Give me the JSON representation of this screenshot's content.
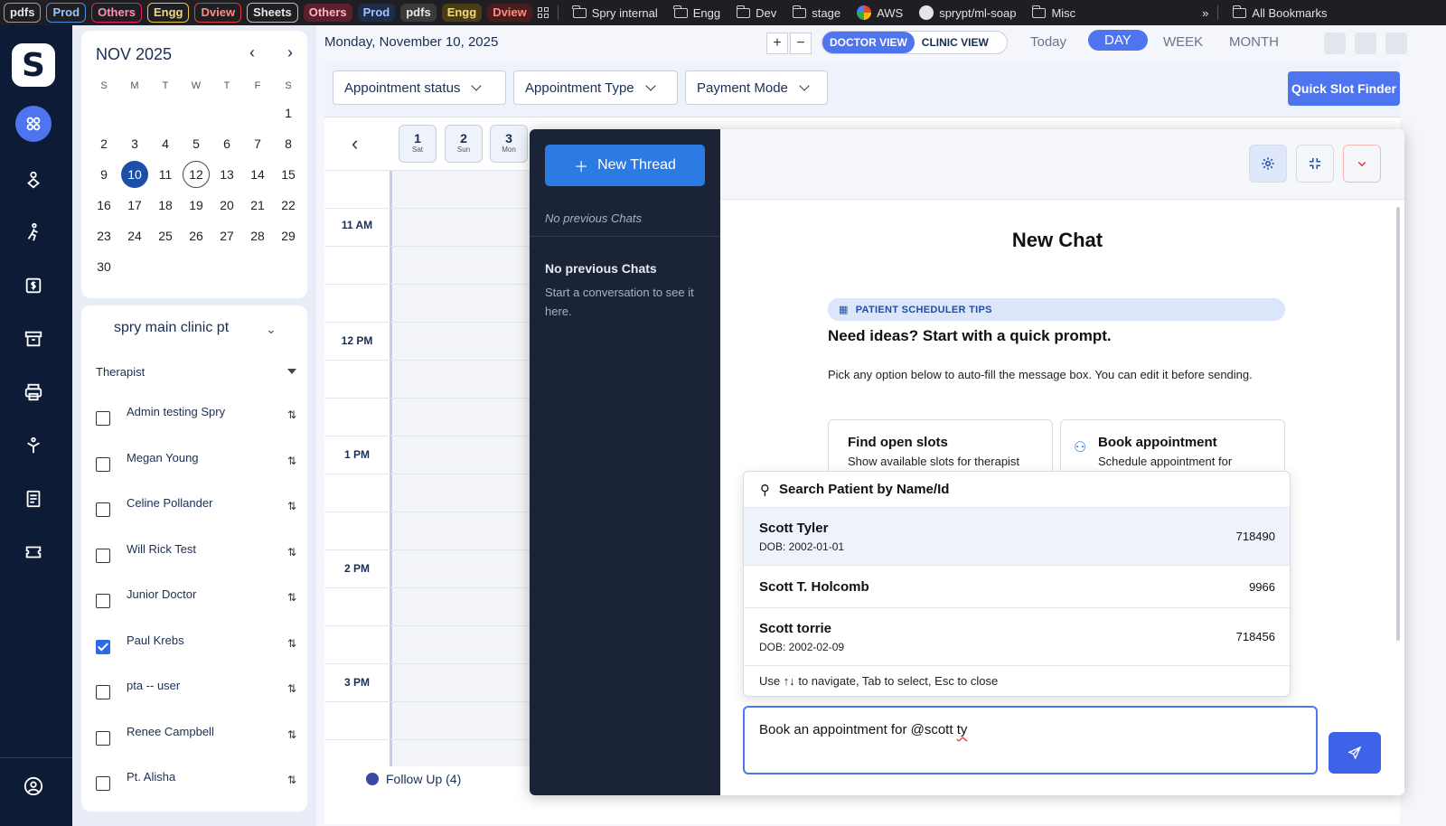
{
  "bookmarks": {
    "chips": [
      {
        "label": "pdfs",
        "color": "#9e9e9e"
      },
      {
        "label": "Prod",
        "color": "#4a90e2"
      },
      {
        "label": "Others",
        "color": "#e91e63"
      },
      {
        "label": "Engg",
        "color": "#f5c542"
      },
      {
        "label": "Dview",
        "color": "#e53935"
      },
      {
        "label": "Sheets",
        "color": "#bdbdbd"
      }
    ],
    "plain": [
      "Others",
      "Prod",
      "pdfs",
      "Engg",
      "Dview"
    ],
    "folders": [
      "Spry internal",
      "Engg",
      "Dev",
      "stage"
    ],
    "links": [
      "AWS",
      "sprypt/ml-soap"
    ],
    "misc_folder": "Misc",
    "overflow": "»",
    "all_bookmarks": "All Bookmarks"
  },
  "leftnav": {
    "logo": "S",
    "icons": [
      "dashboard-icon",
      "patients-icon",
      "exercise-icon",
      "billing-icon",
      "archive-icon",
      "print-icon",
      "therapy-icon",
      "documents-icon",
      "tickets-icon",
      "profile-icon"
    ]
  },
  "calendar": {
    "month_label": "NOV 2025",
    "prev": "‹",
    "next": "›",
    "weekdays": [
      "S",
      "M",
      "T",
      "W",
      "T",
      "F",
      "S"
    ],
    "leading_blanks": 6,
    "days": 30,
    "selected": 10,
    "today": 12
  },
  "therapists": {
    "clinic": "spry main clinic pt",
    "label": "Therapist",
    "list": [
      {
        "name": "Admin testing Spry",
        "checked": false
      },
      {
        "name": "Megan Young",
        "checked": false
      },
      {
        "name": "Celine Pollander",
        "checked": false
      },
      {
        "name": "Will Rick Test",
        "checked": false
      },
      {
        "name": "Junior Doctor",
        "checked": false
      },
      {
        "name": "Paul Krebs",
        "checked": true
      },
      {
        "name": "pta -- user",
        "checked": false
      },
      {
        "name": "Renee Campbell",
        "checked": false
      },
      {
        "name": "Pt. Alisha",
        "checked": false
      }
    ]
  },
  "header": {
    "date": "Monday, November 10, 2025",
    "zoom_in": "+",
    "zoom_out": "−",
    "doctor_view": "DOCTOR VIEW",
    "clinic_view": "CLINIC VIEW",
    "today": "Today",
    "day": "DAY",
    "week": "WEEK",
    "month": "MONTH"
  },
  "filters": {
    "status": "Appointment status",
    "type": "Appointment Type",
    "payment": "Payment Mode",
    "quick_slot": "Quick Slot Finder"
  },
  "schedule": {
    "prev_arrow": "‹",
    "day_chips": [
      {
        "num": "1",
        "dow": "Sat"
      },
      {
        "num": "2",
        "dow": "Sun"
      },
      {
        "num": "3",
        "dow": "Mon"
      }
    ],
    "hours": [
      "11 AM",
      "12 PM",
      "1 PM",
      "2 PM",
      "3 PM"
    ],
    "follow_up": "Follow Up (4)"
  },
  "chat": {
    "new_thread": "New Thread",
    "no_prev_italic": "No previous Chats",
    "no_prev_head": "No previous Chats",
    "no_prev_desc": "Start a conversation to see it here.",
    "title": "New Chat",
    "tips_label": "PATIENT SCHEDULER TIPS",
    "ideas_heading": "Need ideas? Start with a quick prompt.",
    "pick_text": "Pick any option below to auto-fill the message box. You can edit it before sending.",
    "cards": [
      {
        "title": "Find open slots",
        "desc": "Show available slots for therapist"
      },
      {
        "title": "Book appointment",
        "desc": "Schedule appointment for"
      }
    ],
    "search_head": "Search Patient by Name/Id",
    "patients": [
      {
        "name": "Scott Tyler",
        "dob": "DOB: 2002-01-01",
        "id": "718490"
      },
      {
        "name": "Scott T. Holcomb",
        "dob": "",
        "id": "9966"
      },
      {
        "name": "Scott torrie",
        "dob": "DOB: 2002-02-09",
        "id": "718456"
      }
    ],
    "hint": "Use ↑↓ to navigate, Tab to select, Esc to close",
    "input_prefix": "Book an appointment for @scott ",
    "input_typo": "ty"
  }
}
